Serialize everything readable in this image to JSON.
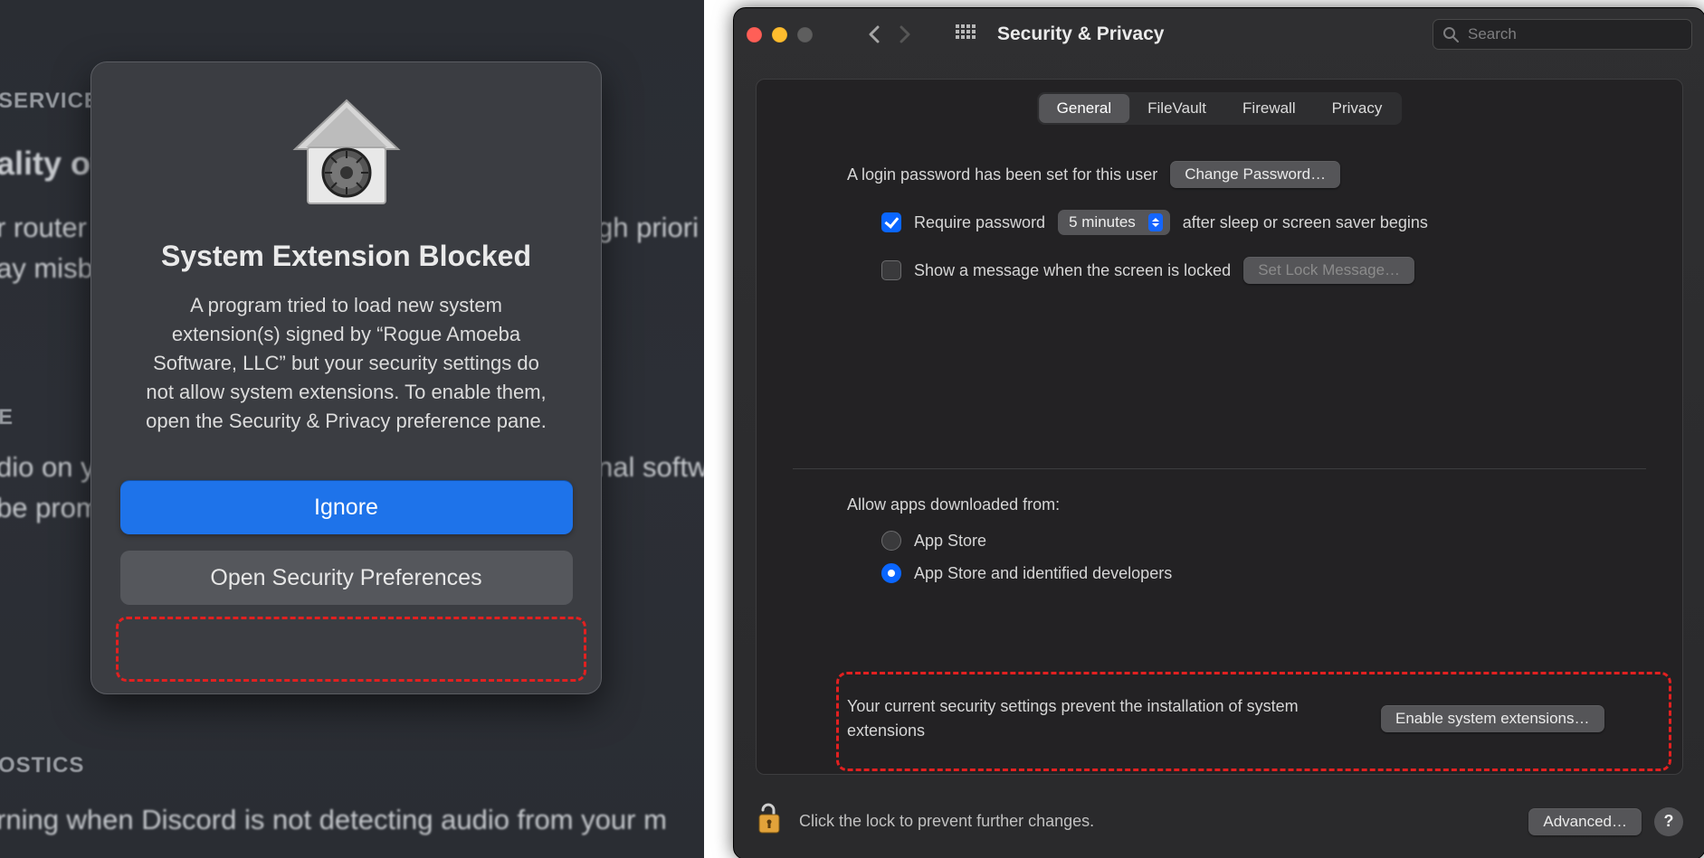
{
  "left": {
    "bg": {
      "heading_service": "SERVICE",
      "line_qos": "ality of S",
      "line_router1": "r router t",
      "line_router2": "ay misbe",
      "line_priority_right": "gh priori",
      "heading_audio": "E",
      "line_audio1": "dio on y",
      "line_audio2": "be prom",
      "line_software_right": "nal softw",
      "heading_diag": "OSTICS",
      "line_footer": "rning when Discord is not detecting audio from your m"
    },
    "modal": {
      "title": "System Extension Blocked",
      "body": "A program tried to load new system extension(s) signed by “Rogue Amoeba Software, LLC” but your security settings do not allow system extensions. To enable them, open the Security & Privacy preference pane.",
      "ignore": "Ignore",
      "open_prefs": "Open Security Preferences"
    }
  },
  "right": {
    "title": "Security & Privacy",
    "search_placeholder": "Search",
    "tabs": [
      "General",
      "FileVault",
      "Firewall",
      "Privacy"
    ],
    "active_tab": "General",
    "login_password_msg": "A login password has been set for this user",
    "change_password": "Change Password…",
    "require_password_pre": "Require password",
    "require_password_select": "5 minutes",
    "require_password_post": "after sleep or screen saver begins",
    "show_message_locked": "Show a message when the screen is locked",
    "set_lock_message": "Set Lock Message…",
    "allow_apps_heading": "Allow apps downloaded from:",
    "radio_appstore": "App Store",
    "radio_appstore_dev": "App Store and identified developers",
    "block_msg": "Your current security settings prevent the installation of system extensions",
    "enable_ext": "Enable system extensions…",
    "lock_msg": "Click the lock to prevent further changes.",
    "advanced": "Advanced…"
  }
}
